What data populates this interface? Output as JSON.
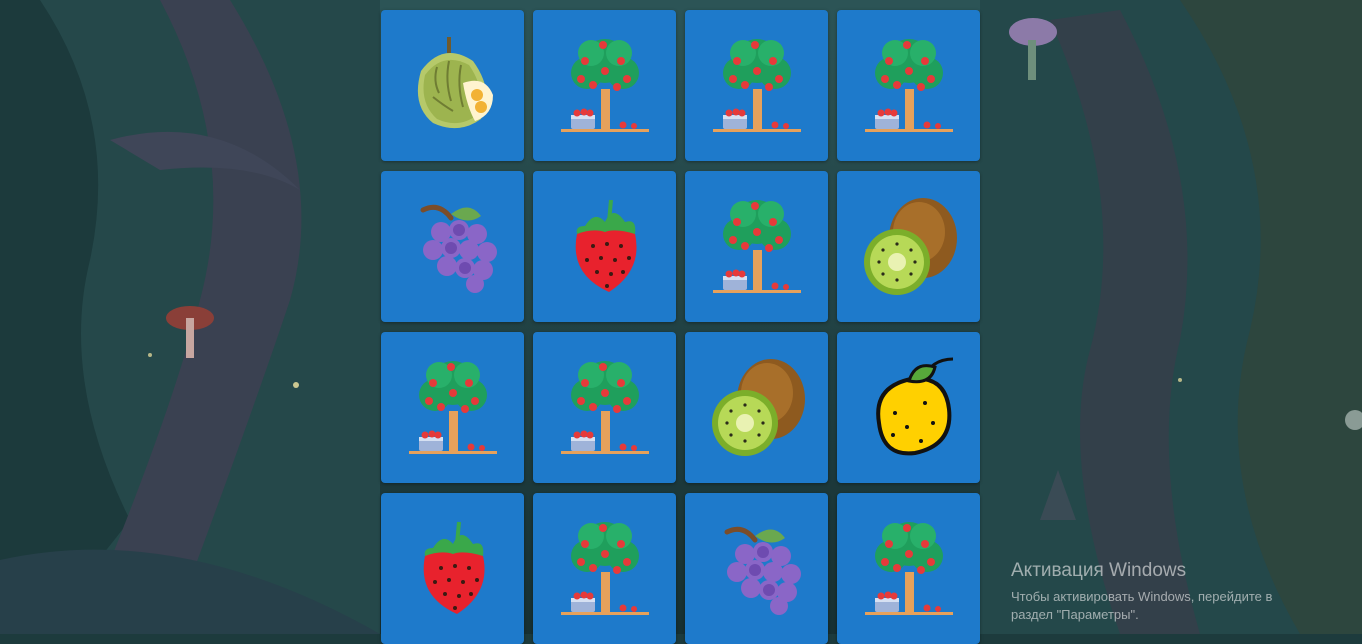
{
  "board": {
    "cards": [
      {
        "fruit": "durian"
      },
      {
        "fruit": "apple-tree"
      },
      {
        "fruit": "apple-tree"
      },
      {
        "fruit": "apple-tree"
      },
      {
        "fruit": "grapes"
      },
      {
        "fruit": "strawberry"
      },
      {
        "fruit": "apple-tree"
      },
      {
        "fruit": "kiwi"
      },
      {
        "fruit": "apple-tree"
      },
      {
        "fruit": "apple-tree"
      },
      {
        "fruit": "kiwi"
      },
      {
        "fruit": "lemon"
      },
      {
        "fruit": "strawberry"
      },
      {
        "fruit": "apple-tree"
      },
      {
        "fruit": "grapes"
      },
      {
        "fruit": "apple-tree"
      }
    ],
    "card_color": "#1e7acb"
  },
  "watermark": {
    "title": "Активация Windows",
    "line1": "Чтобы активировать Windows, перейдите в",
    "line2": "раздел \"Параметры\"."
  }
}
